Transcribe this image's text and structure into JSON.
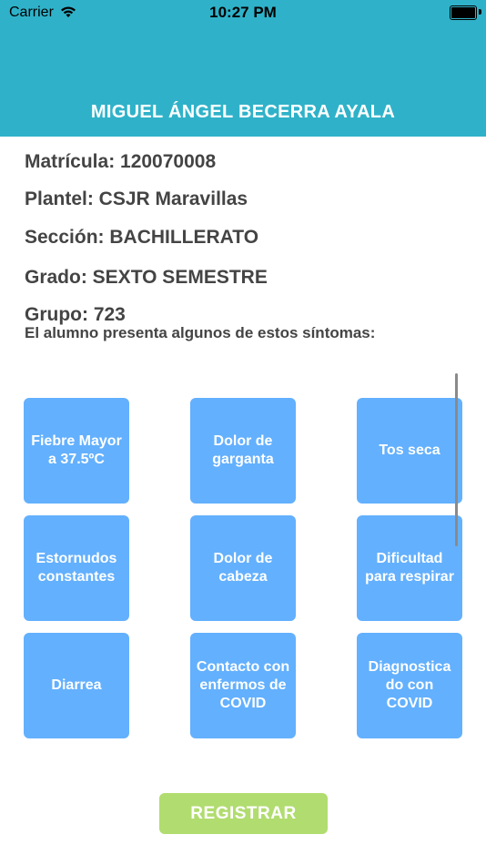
{
  "status_bar": {
    "carrier": "Carrier",
    "time": "10:27 PM",
    "icons": [
      "wifi-icon",
      "battery-icon"
    ]
  },
  "header": {
    "student_name": "MIGUEL ÁNGEL BECERRA AYALA",
    "background_color": "#2fb2c9"
  },
  "student_info": {
    "matricula": "Matrícula: 120070008",
    "plantel": "Plantel: CSJR Maravillas",
    "seccion": "Sección: BACHILLERATO",
    "grado": "Grado: SEXTO SEMESTRE",
    "grupo": "Grupo: 723"
  },
  "prompt": "El alumno presenta algunos de estos síntomas:",
  "symptoms": [
    "Fiebre Mayor a 37.5ºC",
    "Dolor de garganta",
    "Tos seca",
    "Estornudos constantes",
    "Dolor de cabeza",
    "Dificultad para respirar",
    "Diarrea",
    "Contacto con enfermos de COVID",
    "Diagnostica do con COVID"
  ],
  "symptom_color": "#63b0fe",
  "register_button": {
    "label": "REGISTRAR",
    "color": "#b1dc6f"
  }
}
